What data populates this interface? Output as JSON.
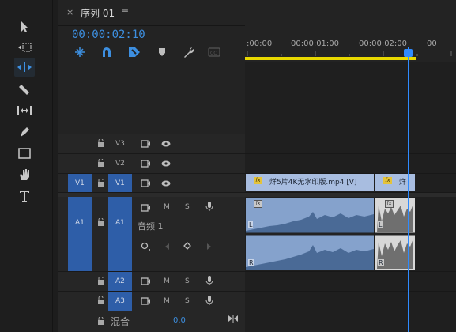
{
  "tools": [
    "selection-tool",
    "track-select-tool",
    "ripple-edit-tool",
    "razor-tool",
    "slip-tool",
    "pen-tool",
    "rectangle-tool",
    "hand-tool",
    "type-tool"
  ],
  "tab": {
    "close": "×",
    "title": "序列 01",
    "menu": "≡"
  },
  "timecode": "00:00:02:10",
  "ruler": {
    "labels": [
      ":00:00",
      "00:00:01:00",
      "00:00:02:00",
      "00"
    ]
  },
  "tracks": {
    "v3": {
      "label": "V3"
    },
    "v2": {
      "label": "V2"
    },
    "v1": {
      "src": "V1",
      "label": "V1"
    },
    "a1": {
      "src": "A1",
      "label": "A1",
      "m": "M",
      "s": "S",
      "name": "音频 1"
    },
    "a2": {
      "label": "A2",
      "m": "M",
      "s": "S"
    },
    "a3": {
      "label": "A3",
      "m": "M",
      "s": "S"
    },
    "mix": {
      "label": "混合",
      "value": "0.0"
    }
  },
  "clips": {
    "v1a": {
      "fx": "fx",
      "label": "烊5片4K无水印版.mp4 [V]"
    },
    "v1b": {
      "fx": "fx",
      "label": "烊"
    },
    "a1a": {
      "fx": "fx",
      "l": "L",
      "r": "R"
    },
    "a1b": {
      "fx": "fx",
      "l": "L",
      "r": "R"
    }
  },
  "colors": {
    "accent": "#3d8fe0",
    "playhead": "#2f8bff",
    "target": "#2e5ea8",
    "clipVideo": "#a8bde0",
    "clipAudio": "#85a2cc",
    "workarea": "#e8d800"
  }
}
